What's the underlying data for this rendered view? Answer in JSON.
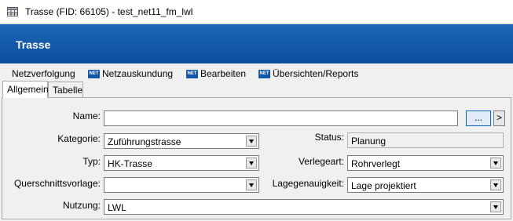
{
  "window": {
    "title": "Trasse (FID: 66105) - test_net11_fm_lwl"
  },
  "banner": {
    "title": "Trasse"
  },
  "menu": [
    {
      "label": "Netzverfolgung",
      "icon": ""
    },
    {
      "label": "Netzauskundung",
      "icon": "net-icon"
    },
    {
      "label": "Bearbeiten",
      "icon": "net-icon"
    },
    {
      "label": "Übersichten/Reports",
      "icon": "net-icon"
    }
  ],
  "net_badge": "NET",
  "tabs": [
    {
      "label": "Allgemein",
      "active": true
    },
    {
      "label": "Tabelle",
      "active": false
    }
  ],
  "form": {
    "name": {
      "label": "Name:",
      "value": "",
      "browse_label": "...",
      "next_label": ">"
    },
    "kategorie": {
      "label": "Kategorie:",
      "value": "Zuführungstrasse"
    },
    "status": {
      "label": "Status:",
      "value": "Planung"
    },
    "typ": {
      "label": "Typ:",
      "value": "HK-Trasse"
    },
    "verlegeart": {
      "label": "Verlegeart:",
      "value": "Rohrverlegt"
    },
    "querschnittsvorlage": {
      "label": "Querschnittsvorlage:",
      "value": ""
    },
    "lagegenauigkeit": {
      "label": "Lagegenauigkeit:",
      "value": "Lage projektiert"
    },
    "nutzung": {
      "label": "Nutzung:",
      "value": "LWL"
    }
  }
}
